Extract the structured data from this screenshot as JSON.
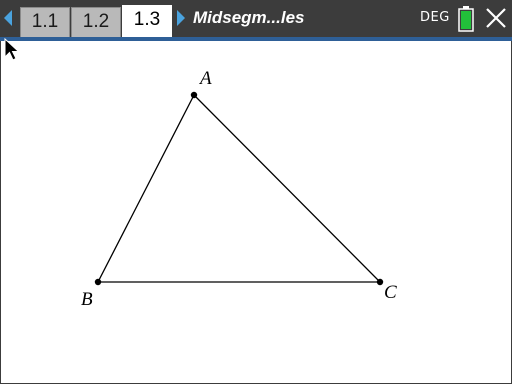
{
  "tabs": [
    {
      "label": "1.1",
      "active": false
    },
    {
      "label": "1.2",
      "active": false
    },
    {
      "label": "1.3",
      "active": true
    }
  ],
  "document": {
    "title": "Midsegm...les"
  },
  "status": {
    "angle_mode": "DEG",
    "battery_color": "#22c03a"
  },
  "colors": {
    "accent": "#4aa3df",
    "header": "#3c3c3c",
    "rule": "#2e5f97"
  },
  "icons": {
    "prev": "triangle-left-icon",
    "next": "triangle-right-icon",
    "battery": "battery-icon",
    "close": "close-icon",
    "pointer": "mouse-pointer-icon"
  },
  "geometry": {
    "shape": "triangle",
    "points": [
      {
        "label": "A"
      },
      {
        "label": "B"
      },
      {
        "label": "C"
      }
    ]
  }
}
